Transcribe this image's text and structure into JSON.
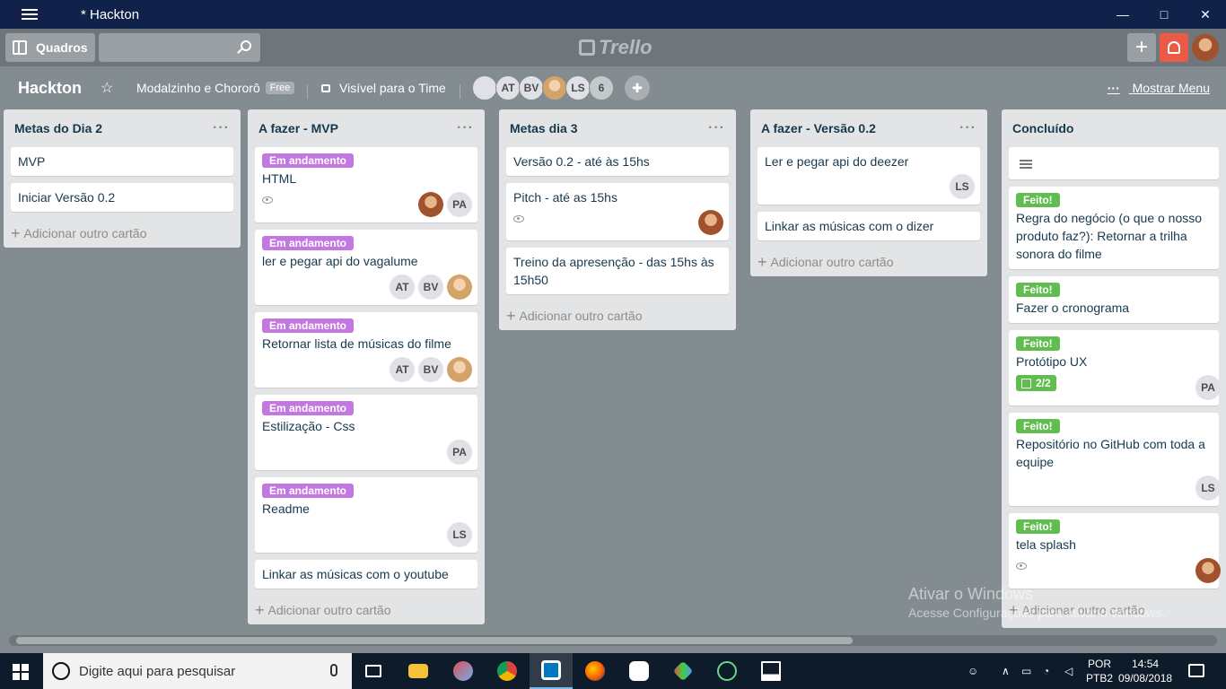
{
  "window": {
    "title": "* Hackton"
  },
  "header": {
    "quadros_label": "Quadros",
    "logo_text": "Trello",
    "plus_label": "+"
  },
  "board": {
    "name": "Hackton",
    "team": "Modalzinho e Chororô",
    "team_badge": "Free",
    "visibility": "Visível para o Time",
    "members": [
      "AT",
      "BV",
      "LS"
    ],
    "members_extra": "6",
    "show_menu": "Mostrar Menu",
    "show_menu_dots": "···"
  },
  "add_card_label": "Adicionar outro cartão",
  "lists": [
    {
      "title": "Metas do Dia 2",
      "cards": [
        {
          "text": "MVP"
        },
        {
          "text": "Iniciar Versão 0.2"
        }
      ]
    },
    {
      "title": "A fazer - MVP",
      "cards": [
        {
          "label": "Em andamento",
          "text": "HTML",
          "members": [
            "PA"
          ]
        },
        {
          "label": "Em andamento",
          "text": "ler e pegar api do vagalume",
          "members": [
            "AT",
            "BV"
          ]
        },
        {
          "label": "Em andamento",
          "text": "Retornar lista de músicas do filme",
          "members": [
            "AT",
            "BV"
          ]
        },
        {
          "label": "Em andamento",
          "text": "Estilização - Css",
          "members": [
            "PA"
          ]
        },
        {
          "label": "Em andamento",
          "text": "Readme",
          "members": [
            "LS"
          ]
        },
        {
          "text": "Linkar as músicas com o youtube"
        }
      ]
    },
    {
      "title": "Metas dia 3",
      "cards": [
        {
          "text": "Versão 0.2 - até às 15hs"
        },
        {
          "text": "Pitch - até as 15hs"
        },
        {
          "text": "Treino da apresenção - das 15hs às 15h50"
        }
      ]
    },
    {
      "title": "A fazer - Versão 0.2",
      "cards": [
        {
          "text": "Ler e pegar api do deezer",
          "members": [
            "LS"
          ]
        },
        {
          "text": "Linkar as músicas com o dizer"
        }
      ]
    },
    {
      "title": "Concluído",
      "cards": [
        {
          "label": "Feito!",
          "text": "Regra do negócio (o que o nosso produto faz?): Retornar a trilha sonora do filme"
        },
        {
          "label": "Feito!",
          "text": "Fazer o cronograma"
        },
        {
          "label": "Feito!",
          "text": "Protótipo UX",
          "checklist": "2/2",
          "members": [
            "PA"
          ]
        },
        {
          "label": "Feito!",
          "text": "Repositório no GitHub com toda a equipe",
          "members": [
            "LS"
          ]
        },
        {
          "label": "Feito!",
          "text": "tela splash"
        }
      ]
    }
  ],
  "watermark": {
    "line1": "Ativar o Windows",
    "line2": "Acesse Configurações para ativar o Windows."
  },
  "taskbar": {
    "search_placeholder": "Digite aqui para pesquisar",
    "lang1": "POR",
    "lang2": "PTB2",
    "time": "14:54",
    "date": "09/08/2018"
  },
  "colors": {
    "label_purple": "#c377e0",
    "label_green": "#61bd4f",
    "notification_red": "#eb5a46",
    "board_bg": "#838c91"
  }
}
